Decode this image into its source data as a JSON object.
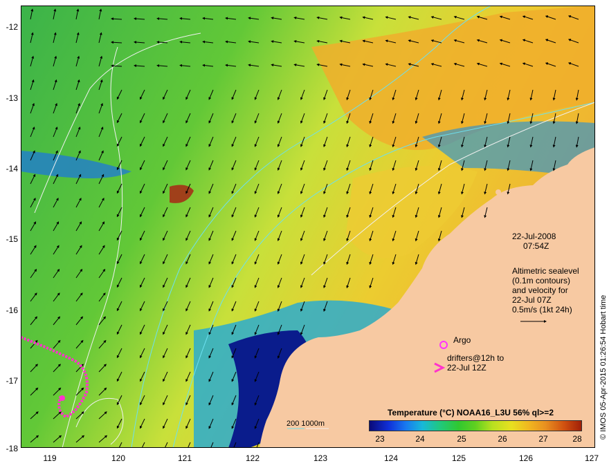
{
  "map": {
    "y_ticks": [
      "-12",
      "-13",
      "-14",
      "-15",
      "-16",
      "-17",
      "-18"
    ],
    "x_ticks": [
      "119",
      "120",
      "121",
      "122",
      "123",
      "124",
      "125",
      "126",
      "127"
    ]
  },
  "annotation": {
    "date": "22-Jul-2008",
    "time": "07:54Z",
    "desc_line1": "Altimetric sealevel",
    "desc_line2": "(0.1m contours)",
    "desc_line3": "and velocity for",
    "desc_line4": "22-Jul 07Z",
    "desc_line5": "0.5m/s (1kt 24h)"
  },
  "legend": {
    "argo_label": "Argo",
    "drifters_line1": "drifters@12h to",
    "drifters_line2": "22-Jul 12Z",
    "scale_label": "200  1000m"
  },
  "colorbar": {
    "title": "Temperature (°C) NOAA16_L3U 56% ql>=2",
    "ticks": [
      "23",
      "24",
      "25",
      "26",
      "27",
      "28"
    ]
  },
  "credit": "© IMOS 05-Apr-2015 01:26:54 Hobart time",
  "colors": {
    "land": "#f7c9a2",
    "drifter": "#ff33cc",
    "argo": "#ff33ff"
  }
}
